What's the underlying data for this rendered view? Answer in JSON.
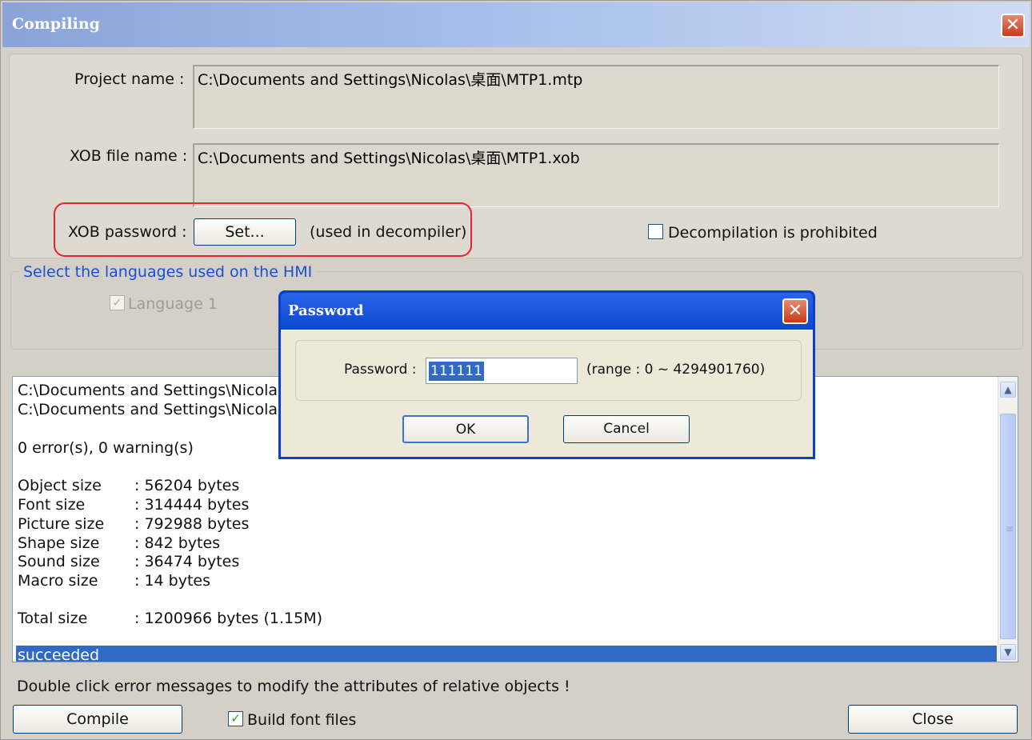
{
  "window": {
    "title": "Compiling",
    "close_glyph": "✕"
  },
  "project": {
    "project_label": "Project name :",
    "project_value": "C:\\Documents and Settings\\Nicolas\\桌面\\MTP1.mtp",
    "xob_label": "XOB file name :",
    "xob_value": "C:\\Documents and Settings\\Nicolas\\桌面\\MTP1.xob",
    "password_label": "XOB password :",
    "set_button": "Set...",
    "used_note": "(used in decompiler)",
    "decompile_label": "Decompilation is prohibited",
    "decompile_checked": false
  },
  "languages": {
    "group_label": "Select the languages used on the HMI",
    "items": [
      {
        "label": "Language 1",
        "checked": true,
        "disabled": true
      }
    ]
  },
  "log": {
    "lines": [
      "C:\\Documents and Settings\\Nicolas\\",
      "C:\\Documents and Settings\\Nicolas\\",
      "",
      "0 error(s), 0 warning(s)",
      "",
      "Object size",
      "Font size",
      "Picture size",
      "Shape size",
      "Sound size",
      "Macro size",
      "",
      "Total size"
    ],
    "stats": [
      {
        "name": "Object size",
        "value": ": 56204 bytes"
      },
      {
        "name": "Font size",
        "value": ": 314444 bytes"
      },
      {
        "name": "Picture size",
        "value": ": 792988 bytes"
      },
      {
        "name": "Shape size",
        "value": ": 842 bytes"
      },
      {
        "name": "Sound size",
        "value": ": 36474 bytes"
      },
      {
        "name": "Macro size",
        "value": ": 14 bytes"
      }
    ],
    "total": {
      "name": "Total size",
      "value": ": 1200966 bytes (1.15M)"
    },
    "path1": "C:\\Documents and Settings\\Nicolas\\",
    "path2": "C:\\Documents and Settings\\Nicolas\\",
    "errors": "0 error(s), 0 warning(s)",
    "selected": "succeeded"
  },
  "footer": {
    "hint": "Double click  error messages  to modify the attributes of  relative objects !",
    "compile_button": "Compile",
    "build_fonts_label": "Build font files",
    "build_fonts_checked": true,
    "close_button": "Close"
  },
  "password_dialog": {
    "title": "Password",
    "label": "Password :",
    "value": "111111",
    "range": "(range : 0 ~ 4294901760)",
    "ok": "OK",
    "cancel": "Cancel"
  },
  "colors": {
    "selection": "#316ac5",
    "highlight_ring": "#e8232b",
    "dialog_frame": "#0a3fc6"
  }
}
